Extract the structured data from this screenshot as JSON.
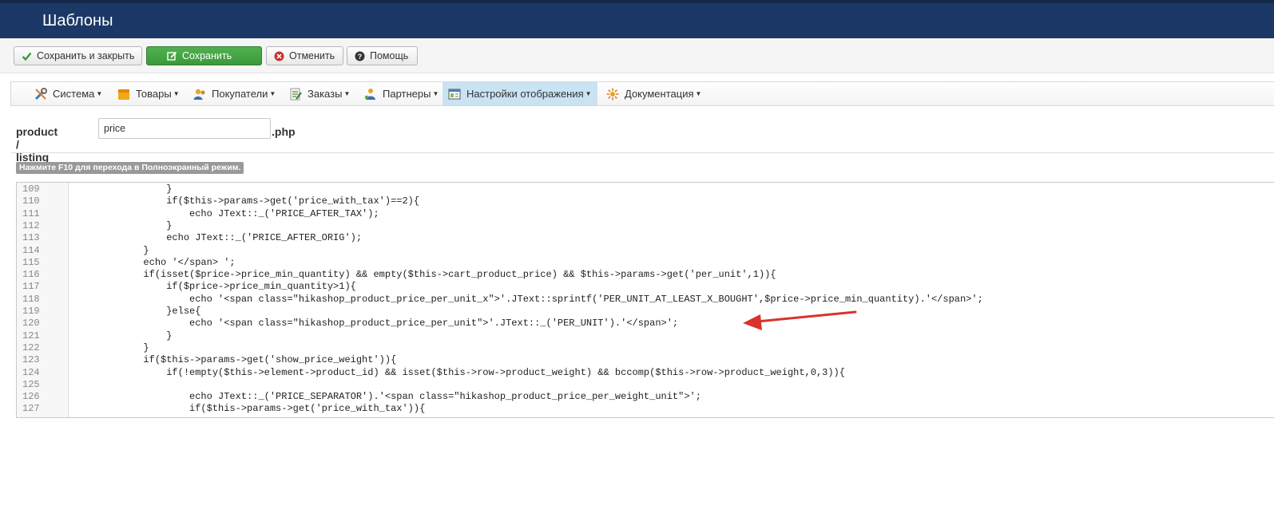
{
  "header": {
    "title": "Шаблоны"
  },
  "toolbar": {
    "save_close": "Сохранить и закрыть",
    "save": "Сохранить",
    "cancel": "Отменить",
    "help": "Помощь"
  },
  "menu": {
    "items": [
      {
        "label": "Система",
        "icon": "tools-icon"
      },
      {
        "label": "Товары",
        "icon": "box-icon"
      },
      {
        "label": "Покупатели",
        "icon": "users-icon"
      },
      {
        "label": "Заказы",
        "icon": "orders-icon"
      },
      {
        "label": "Партнеры",
        "icon": "partners-icon"
      },
      {
        "label": "Настройки отображения",
        "icon": "display-settings-icon",
        "active": true
      },
      {
        "label": "Документация",
        "icon": "documentation-icon"
      }
    ]
  },
  "file": {
    "prefix": "product / listing_",
    "name_value": "price",
    "suffix": ".php"
  },
  "editor": {
    "hint": "Нажмите F10 для перехода в Полноэкранный режим.",
    "lines": [
      {
        "n": "109",
        "code": "                }"
      },
      {
        "n": "110",
        "code": "                if($this->params->get('price_with_tax')==2){"
      },
      {
        "n": "111",
        "code": "                    echo JText::_('PRICE_AFTER_TAX');"
      },
      {
        "n": "112",
        "code": "                }"
      },
      {
        "n": "113",
        "code": "                echo JText::_('PRICE_AFTER_ORIG');"
      },
      {
        "n": "114",
        "code": "            }"
      },
      {
        "n": "115",
        "code": "            echo '</span> ';"
      },
      {
        "n": "116",
        "code": "            if(isset($price->price_min_quantity) && empty($this->cart_product_price) && $this->params->get('per_unit',1)){"
      },
      {
        "n": "117",
        "code": "                if($price->price_min_quantity>1){"
      },
      {
        "n": "118",
        "code": "                    echo '<span class=\"hikashop_product_price_per_unit_x\">'.JText::sprintf('PER_UNIT_AT_LEAST_X_BOUGHT',$price->price_min_quantity).'</span>';"
      },
      {
        "n": "119",
        "code": "                }else{"
      },
      {
        "n": "120",
        "code": "                    echo '<span class=\"hikashop_product_price_per_unit\">'.JText::_('PER_UNIT').'</span>';"
      },
      {
        "n": "121",
        "code": "                }"
      },
      {
        "n": "122",
        "code": "            }"
      },
      {
        "n": "123",
        "code": "            if($this->params->get('show_price_weight')){"
      },
      {
        "n": "124",
        "code": "                if(!empty($this->element->product_id) && isset($this->row->product_weight) && bccomp($this->row->product_weight,0,3)){"
      },
      {
        "n": "125",
        "code": ""
      },
      {
        "n": "126",
        "code": "                    echo JText::_('PRICE_SEPARATOR').'<span class=\"hikashop_product_price_per_weight_unit\">';"
      },
      {
        "n": "127",
        "code": "                    if($this->params->get('price_with_tax')){"
      }
    ]
  },
  "colors": {
    "header_bg": "#1c3866",
    "save_green": "#3b9a3b",
    "active_menu": "#c9e3f3",
    "arrow": "#d9332b"
  }
}
